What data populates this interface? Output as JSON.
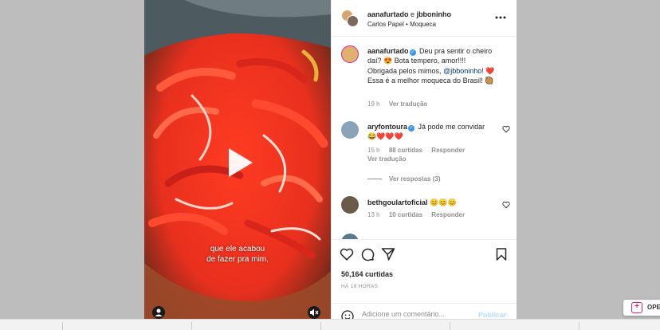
{
  "post": {
    "authors": {
      "first": "aanafurtado",
      "conjunction": "e",
      "second": "jbboninho"
    },
    "subtitle": {
      "location": "Carlos Papel",
      "separator": "•",
      "audio": "Moqueca"
    }
  },
  "video": {
    "caption_lines": [
      "que ele acabou",
      "de fazer pra mim,"
    ]
  },
  "comments": [
    {
      "user": "aanafurtado",
      "verified": true,
      "text_before": "Deu pra sentir o cheiro daí? 😍 Bota tempero, amor!!!! Obrigada pelos mimos,",
      "mention": "@jbboninho",
      "text_after": "! ❤️ Essa é a melhor moqueca do Brasil! 🥘",
      "time": "19 h",
      "translate": "Ver tradução"
    },
    {
      "user": "aryfontoura",
      "verified": true,
      "text": "Já pode me convidar 😂❤️❤️❤️",
      "time": "15 h",
      "likes": "88 curtidas",
      "reply": "Responder",
      "translate": "Ver tradução",
      "view_replies": "Ver respostas (3)"
    },
    {
      "user": "bethgoulartoficial",
      "verified": false,
      "text": "😊😊😊",
      "time": "13 h",
      "likes": "10 curtidas",
      "reply": "Responder"
    }
  ],
  "footer": {
    "likes": "50,164 curtidas",
    "ago": "HÁ 19 HORAS",
    "comment_placeholder": "Adicione um comentário...",
    "publish": "Publicar"
  },
  "side_chip": {
    "label": "OPE"
  },
  "colors": {
    "accent": "#0095f6",
    "verified": "#3897f0",
    "publish_disabled": "#b2dffc"
  }
}
